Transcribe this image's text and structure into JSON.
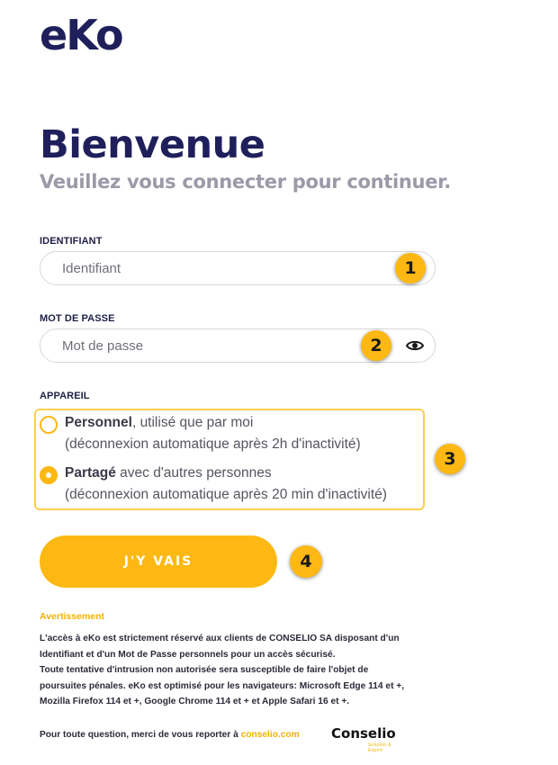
{
  "logo": {
    "text": "eKo"
  },
  "header": {
    "title": "Bienvenue",
    "subtitle": "Veuillez vous connecter pour continuer."
  },
  "form": {
    "identifier": {
      "label": "IDENTIFIANT",
      "placeholder": "Identifiant",
      "value": ""
    },
    "password": {
      "label": "MOT DE PASSE",
      "placeholder": "Mot de passe",
      "value": "",
      "toggle_icon": "eye-icon"
    },
    "device": {
      "label": "APPAREIL",
      "options": [
        {
          "bold": "Personnel",
          "rest": ", utilisé que par moi",
          "detail": "(déconnexion automatique après 2h d'inactivité)",
          "checked": false
        },
        {
          "bold": "Partagé",
          "rest": " avec d'autres personnes",
          "detail": "(déconnexion automatique après 20 min d'inactivité)",
          "checked": true
        }
      ]
    },
    "submit_label": "J'Y VAIS"
  },
  "annotations": [
    "1",
    "2",
    "3",
    "4"
  ],
  "warning": {
    "title": "Avertissement",
    "lines": [
      "L'accès à eKo est strictement réservé aux clients de CONSELIO SA disposant d'un",
      "Identifiant et d'un Mot de Passe personnels pour un accès sécurisé.",
      "Toute tentative d'intrusion non autorisée sera susceptible de faire l'objet de",
      "poursuites pénales. eKo est optimisé pour les navigateurs: Microsoft Edge 114 et +,",
      "Mozilla Firefox 114 et +, Google Chrome 114 et + et Apple Safari 16 et +."
    ]
  },
  "footer": {
    "text": "Pour toute question, merci de vous reporter à ",
    "link": "conselio.com",
    "brand": "Conselio",
    "brand_tagline": "Solution & Expert"
  },
  "colors": {
    "accent": "#fdb813",
    "navy": "#1f1f5c",
    "muted": "#9a9aa8"
  }
}
